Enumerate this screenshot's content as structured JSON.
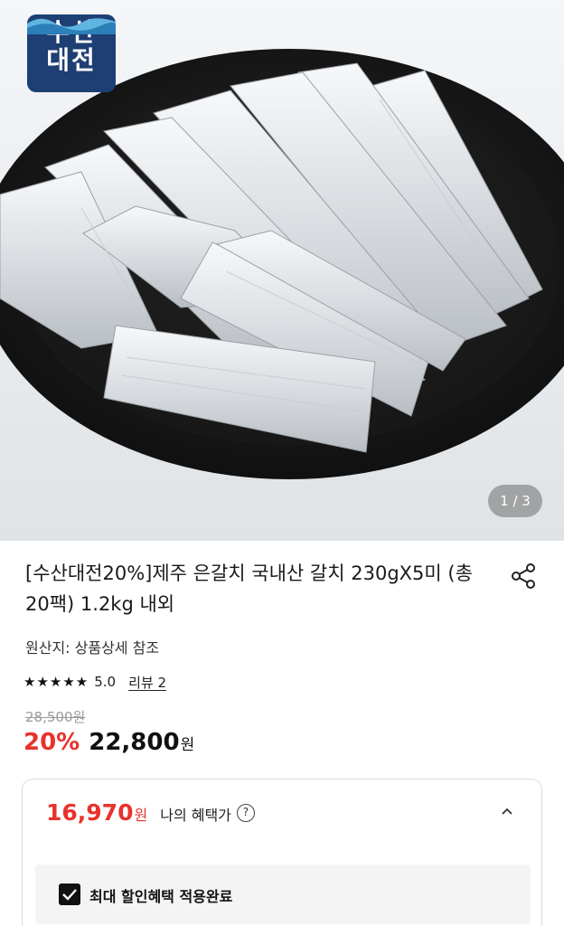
{
  "badge": {
    "line1": "수산",
    "line2": "대전"
  },
  "gallery": {
    "counter": "1 / 3"
  },
  "product": {
    "title": "[수산대전20%]제주 은갈치 국내산 갈치 230gX5미 (총 20팩) 1.2kg 내외",
    "origin": "원산지: 상품상세 참조",
    "stars": "★★★★★",
    "rating": "5.0",
    "review_link": "리뷰 2",
    "original_price": "28,500원",
    "discount_rate": "20%",
    "sale_price": "22,800",
    "currency": "원"
  },
  "benefit": {
    "price": "16,970",
    "currency": "원",
    "label": "나의 혜택가",
    "help": "?",
    "applied_label": "최대 할인혜택 적용완료"
  },
  "icons": [
    "share-icon",
    "help-icon",
    "chevron-up-icon",
    "checkbox-checked-icon"
  ],
  "colors": {
    "accent_red": "#e8322b",
    "badge_navy": "#1d3f74",
    "text": "#111111"
  }
}
